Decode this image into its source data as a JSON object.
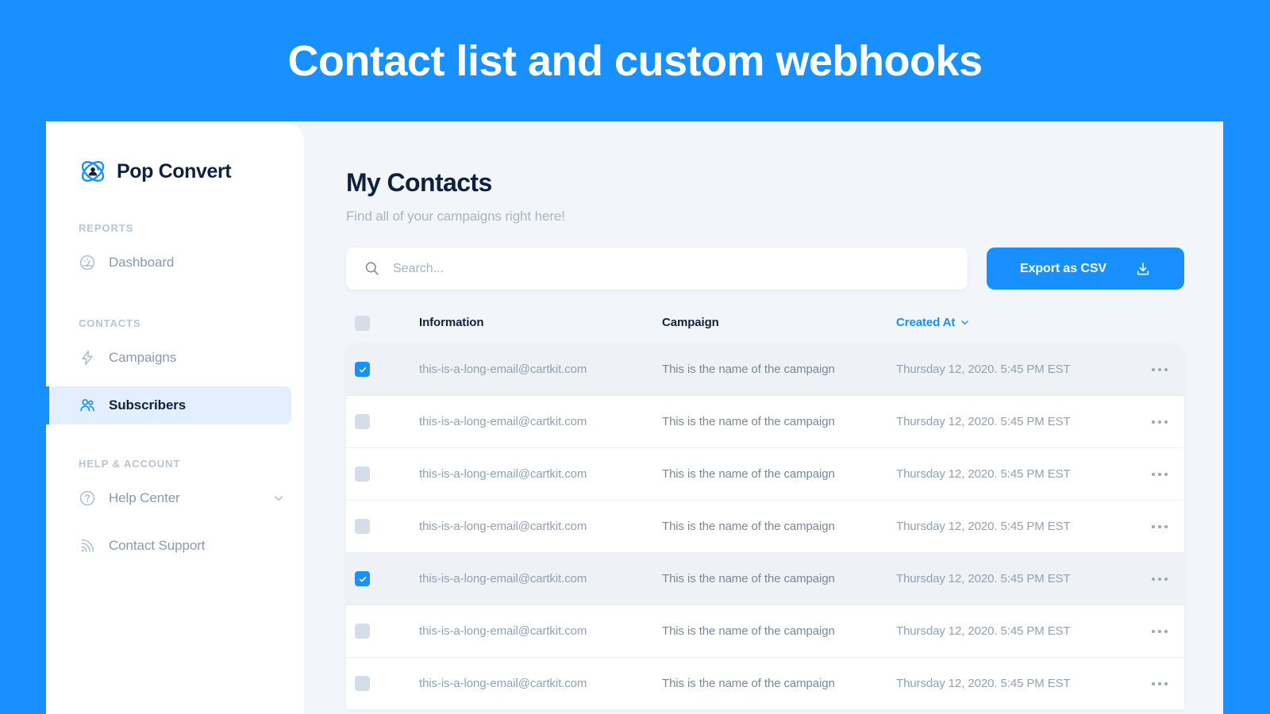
{
  "banner": {
    "title": "Contact list and custom webhooks",
    "background_color": "#1890FF",
    "text_color": "#FFFFFF"
  },
  "theme": {
    "accent": "#1890FF",
    "app_background": "#F2F5F9",
    "sidebar_background": "#FFFFFF",
    "heading_color": "#10213F",
    "muted_text": "#8D99AB",
    "selected_row": "#EEF2F7",
    "active_nav_background": "#E3EFFE",
    "checkbox_unchecked": "#D4DDE8"
  },
  "sidebar": {
    "brand": {
      "name": "Pop Convert",
      "logo_icon": "pop-convert-atom-logo"
    },
    "sections": [
      {
        "label": "REPORTS",
        "items": [
          {
            "label": "Dashboard",
            "icon": "gauge-icon",
            "active": false,
            "has_chevron": false
          }
        ]
      },
      {
        "label": "CONTACTS",
        "items": [
          {
            "label": "Campaigns",
            "icon": "lightning-bolt-icon",
            "active": false,
            "has_chevron": false
          },
          {
            "label": "Subscribers",
            "icon": "users-icon",
            "active": true,
            "has_chevron": false
          }
        ]
      },
      {
        "label": "HELP & ACCOUNT",
        "items": [
          {
            "label": "Help Center",
            "icon": "question-circle-icon",
            "active": false,
            "has_chevron": true
          },
          {
            "label": "Contact Support",
            "icon": "signal-waves-icon",
            "active": false,
            "has_chevron": false
          }
        ]
      }
    ]
  },
  "main": {
    "page_title": "My Contacts",
    "page_subtitle": "Find all of your campaigns right here!",
    "search": {
      "value": "",
      "placeholder": "Search...",
      "icon": "search-icon"
    },
    "export_button": {
      "label": "Export as CSV",
      "icon": "download-icon"
    },
    "table": {
      "columns": [
        {
          "key": "check",
          "label": "",
          "sortable": false
        },
        {
          "key": "info",
          "label": "Information",
          "sortable": false
        },
        {
          "key": "camp",
          "label": "Campaign",
          "sortable": false
        },
        {
          "key": "date",
          "label": "Created At",
          "sortable": true,
          "sort_icon": "chevron-down-icon"
        },
        {
          "key": "menu",
          "label": "",
          "sortable": false
        }
      ],
      "header_checkbox_checked": false,
      "row_menu_icon": "ellipsis-icon",
      "rows": [
        {
          "checked": true,
          "information": "this-is-a-long-email@cartkit.com",
          "campaign": "This is the name of the campaign",
          "created_at": "Thursday 12, 2020. 5:45 PM EST"
        },
        {
          "checked": false,
          "information": "this-is-a-long-email@cartkit.com",
          "campaign": "This is the name of the campaign",
          "created_at": "Thursday 12, 2020. 5:45 PM EST"
        },
        {
          "checked": false,
          "information": "this-is-a-long-email@cartkit.com",
          "campaign": "This is the name of the campaign",
          "created_at": "Thursday 12, 2020. 5:45 PM EST"
        },
        {
          "checked": false,
          "information": "this-is-a-long-email@cartkit.com",
          "campaign": "This is the name of the campaign",
          "created_at": "Thursday 12, 2020. 5:45 PM EST"
        },
        {
          "checked": true,
          "information": "this-is-a-long-email@cartkit.com",
          "campaign": "This is the name of the campaign",
          "created_at": "Thursday 12, 2020. 5:45 PM EST"
        },
        {
          "checked": false,
          "information": "this-is-a-long-email@cartkit.com",
          "campaign": "This is the name of the campaign",
          "created_at": "Thursday 12, 2020. 5:45 PM EST"
        },
        {
          "checked": false,
          "information": "this-is-a-long-email@cartkit.com",
          "campaign": "This is the name of the campaign",
          "created_at": "Thursday 12, 2020. 5:45 PM EST"
        }
      ]
    }
  }
}
